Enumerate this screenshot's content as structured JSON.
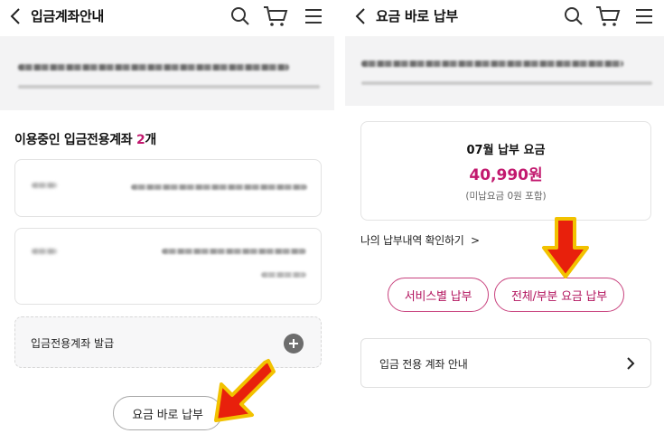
{
  "left": {
    "header": {
      "title": "입금계좌안내"
    },
    "section": {
      "title_prefix": "이용중인 입금전용계좌 ",
      "count": "2",
      "title_suffix": "개"
    },
    "issue_row": {
      "label": "입금전용계좌 발급"
    },
    "pay_button": {
      "label": "요금 바로 납부"
    }
  },
  "right": {
    "header": {
      "title": "요금 바로 납부"
    },
    "fee": {
      "title": "07월 납부 요금",
      "amount": "40,990원",
      "note": "(미납요금 0원 포함)"
    },
    "history_link": {
      "label": "나의 납부내역 확인하기",
      "chevron": ">"
    },
    "buttons": {
      "by_service": "서비스별 납부",
      "full_partial": "전체/부분 요금 납부"
    },
    "guide": {
      "label": "입금 전용 계좌 안내"
    }
  },
  "icons": [
    "back-chevron-icon",
    "search-icon",
    "cart-icon",
    "menu-icon",
    "plus-icon",
    "chevron-right-icon",
    "red-arrow-icon"
  ],
  "colors": {
    "accent_pink": "#c2186e",
    "arrow_red": "#e8200c",
    "arrow_gold": "#f2c200"
  }
}
